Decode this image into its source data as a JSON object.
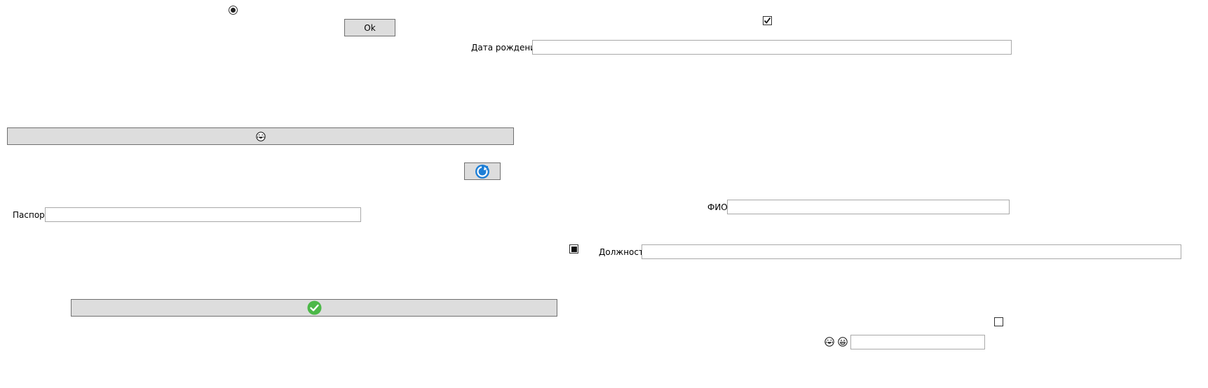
{
  "form": {
    "ok_label": "Ok",
    "birth_date_label": "Дата рождения",
    "birth_date_value": "",
    "passport_label": "Паспорт",
    "passport_value": "",
    "fio_label": "ФИО",
    "fio_value": "",
    "position_label": "Должность",
    "position_value": "",
    "emoji_field_value": ""
  },
  "controls": {
    "radio_selected": true,
    "checkbox_top_checked": true,
    "checkbox_mid_indeterminate": true,
    "checkbox_bottom_checked": false
  },
  "icons": {
    "wide_button_icon": "laughing-face-icon",
    "round_button_icon": "refresh-blue-icon",
    "confirm_button_icon": "green-check-circle-icon",
    "emoji_left_icon": "laughing-face-icon",
    "emoji_right_icon": "grinning-face-icon"
  },
  "colors": {
    "button_face": "#dddddd",
    "button_border": "#707070",
    "field_border": "#a9a9a9",
    "check_green": "#4cb848",
    "refresh_blue": "#1e7fd6"
  }
}
